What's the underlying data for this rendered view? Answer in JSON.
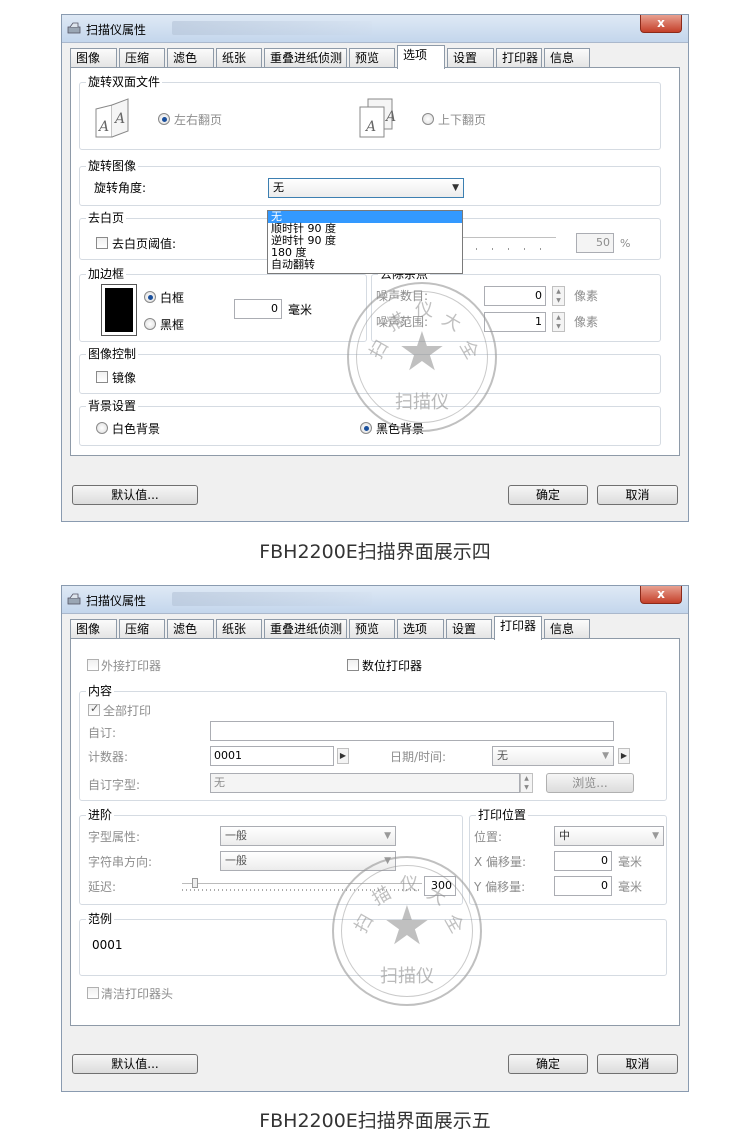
{
  "common": {
    "window_title": "扫描仪属性",
    "close_glyph": "x",
    "tabs": [
      "图像",
      "压缩",
      "滤色",
      "纸张",
      "重叠进纸侦测",
      "预览",
      "选项",
      "设置",
      "打印器",
      "信息"
    ],
    "default_button": "默认值...",
    "ok_button": "确定",
    "cancel_button": "取消",
    "stamp_text": "扫描仪",
    "stamp_arc": [
      "扫",
      "描",
      "仪",
      "大",
      "全"
    ]
  },
  "screen1": {
    "active_tab": "选项",
    "caption": "FBH2200E扫描界面展示四",
    "rotate_duplex": {
      "label": "旋转双面文件",
      "option_left": "左右翻页",
      "option_top": "上下翻页",
      "selected": "左右翻页"
    },
    "rotate_image": {
      "label": "旋转图像",
      "angle_label": "旋转角度:",
      "angle_value": "无",
      "options": [
        "无",
        "顺时针 90 度",
        "逆时针 90 度",
        "180 度",
        "自动翻转"
      ]
    },
    "blank_page": {
      "label": "去白页",
      "threshold_label": "去白页阈值:",
      "threshold_value": "50",
      "threshold_unit": "%",
      "checked": false
    },
    "border": {
      "label": "加边框",
      "white": "白框",
      "black": "黑框",
      "selected": "白框",
      "value": "0",
      "unit": "毫米"
    },
    "despeckle": {
      "label": "去除杂点",
      "noise_count_label": "噪声数目:",
      "noise_count_value": "0",
      "noise_range_label": "噪声范围:",
      "noise_range_value": "1",
      "unit": "像素"
    },
    "image_control": {
      "label": "图像控制",
      "mirror": "镜像",
      "checked": false
    },
    "background": {
      "label": "背景设置",
      "white": "白色背景",
      "black": "黑色背景",
      "selected": "黑色背景"
    }
  },
  "screen2": {
    "active_tab": "打印器",
    "caption": "FBH2200E扫描界面展示五",
    "external_printer": "外接打印器",
    "digital_printer": "数位打印器",
    "content": {
      "label": "内容",
      "print_all": "全部打印",
      "custom_label": "自订:",
      "custom_value": "",
      "counter_label": "计数器:",
      "counter_value": "0001",
      "datetime_label": "日期/时间:",
      "datetime_value": "无",
      "custom_font_label": "自订字型:",
      "custom_font_value": "无",
      "browse_button": "浏览..."
    },
    "advanced": {
      "label": "进阶",
      "font_attr_label": "字型属性:",
      "font_attr_value": "一般",
      "direction_label": "字符串方向:",
      "direction_value": "一般",
      "delay_label": "延迟:",
      "delay_value": "300"
    },
    "print_position": {
      "label": "打印位置",
      "position_label": "位置:",
      "position_value": "中",
      "x_offset_label": "X 偏移量:",
      "x_offset_value": "0",
      "y_offset_label": "Y 偏移量:",
      "y_offset_value": "0",
      "unit": "毫米"
    },
    "sample": {
      "label": "范例",
      "value": "0001"
    },
    "clean_head": "清洁打印器头"
  }
}
